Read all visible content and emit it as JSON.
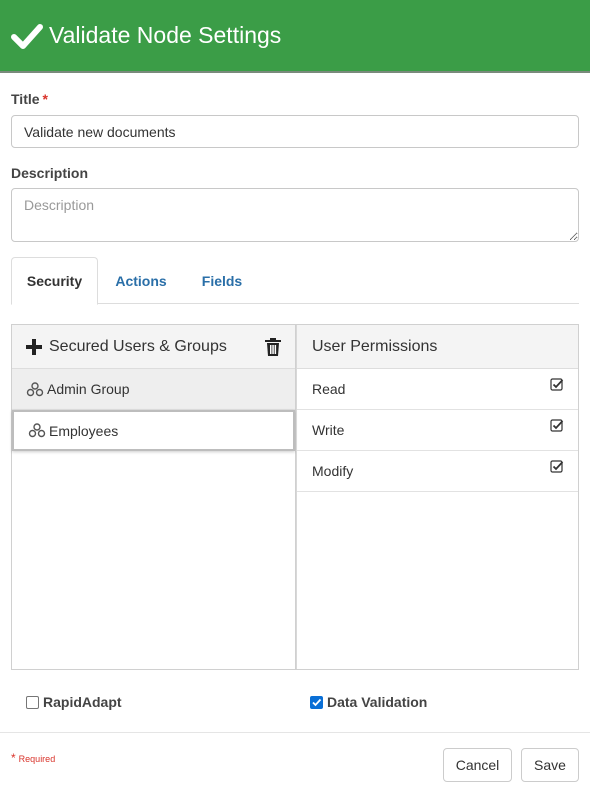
{
  "header": {
    "title": "Validate Node Settings",
    "icon": "checkmark-icon",
    "color": "#3b9d47"
  },
  "form": {
    "title_label": "Title",
    "required_star": "*",
    "title_value": "Validate new documents",
    "description_label": "Description",
    "description_placeholder": "Description"
  },
  "tabs": [
    {
      "label": "Security",
      "active": true
    },
    {
      "label": "Actions",
      "active": false
    },
    {
      "label": "Fields",
      "active": false
    }
  ],
  "users_panel": {
    "header": "Secured Users & Groups",
    "groups": [
      {
        "label": "Admin Group",
        "icon": "group-icon"
      },
      {
        "label": "Employees",
        "icon": "group-icon",
        "selected": true
      }
    ]
  },
  "permissions_panel": {
    "header": "User Permissions",
    "permissions": [
      {
        "label": "Read",
        "checked": true
      },
      {
        "label": "Write",
        "checked": true
      },
      {
        "label": "Modify",
        "checked": true
      }
    ]
  },
  "options": {
    "rapidadapt_label": "RapidAdapt",
    "rapidadapt_checked": false,
    "data_validation_label": "Data Validation",
    "data_validation_checked": true
  },
  "footer": {
    "required_star": "*",
    "required_text": "Required",
    "cancel_label": "Cancel",
    "save_label": "Save"
  }
}
